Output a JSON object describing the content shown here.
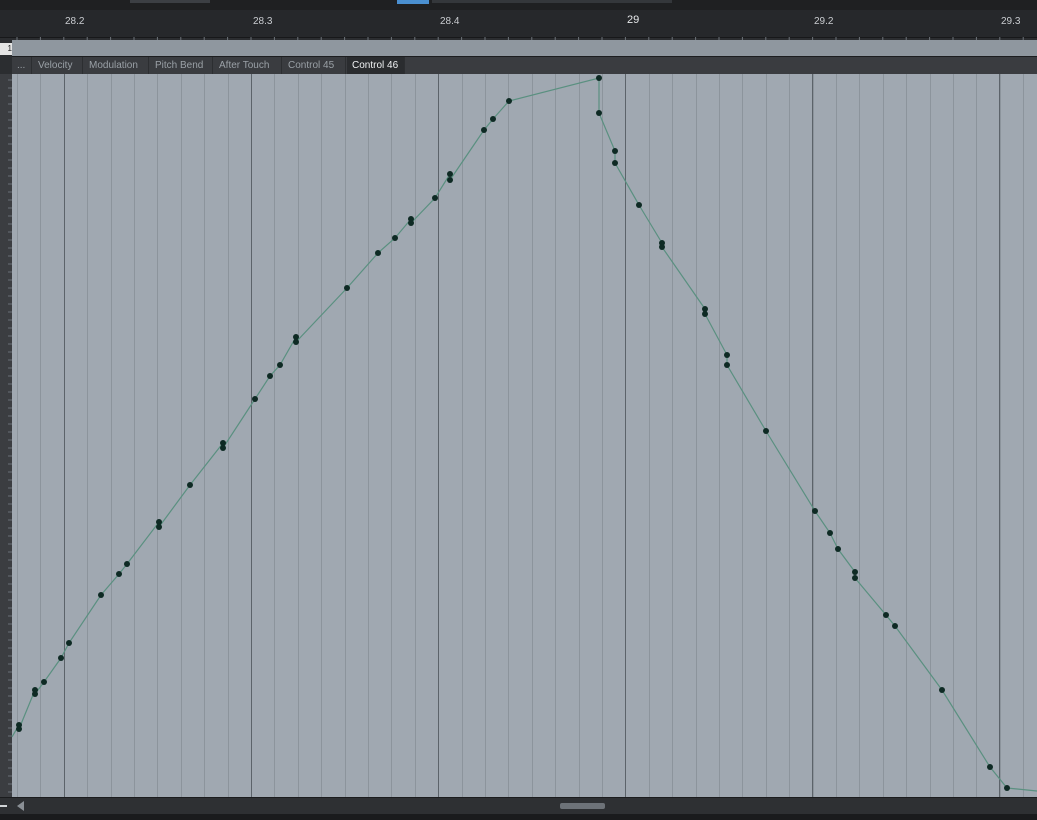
{
  "ruler": {
    "labels": [
      {
        "text": "28.2",
        "major": false
      },
      {
        "text": "28.3",
        "major": false
      },
      {
        "text": "28.4",
        "major": false
      },
      {
        "text": "29",
        "major": true
      },
      {
        "text": "29.2",
        "major": false
      },
      {
        "text": "29.3",
        "major": false
      }
    ]
  },
  "strip": {
    "number": "1"
  },
  "tabs": [
    {
      "label": "...",
      "active": false
    },
    {
      "label": "Velocity",
      "active": false
    },
    {
      "label": "Modulation",
      "active": false
    },
    {
      "label": "Pitch Bend",
      "active": false
    },
    {
      "label": "After Touch",
      "active": false
    },
    {
      "label": "Control 45",
      "active": false
    },
    {
      "label": "Control 46",
      "active": true
    }
  ],
  "automation": {
    "line_color": "#5a9080",
    "point_color": "#0e2a24"
  },
  "colors": {
    "accent": "#4a8fd0"
  }
}
